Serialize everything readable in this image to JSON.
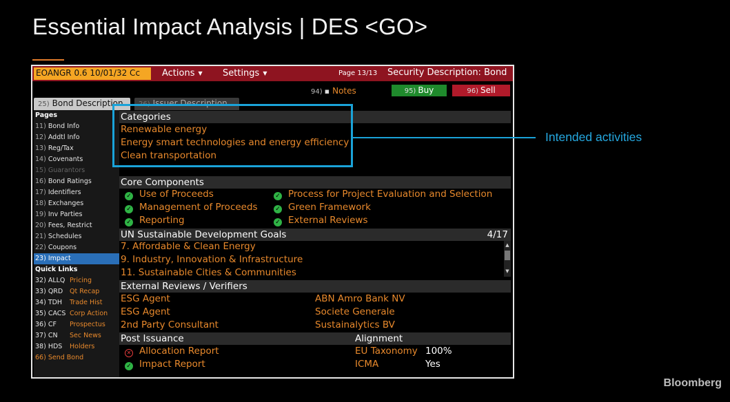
{
  "slide": {
    "title": "Essential Impact Analysis | DES <GO>",
    "brand": "Bloomberg"
  },
  "callout": {
    "label": "Intended activities"
  },
  "topbar": {
    "ticker": "EOANGR 0.6 10/01/32 Cc",
    "actions": "Actions",
    "settings": "Settings",
    "page": "Page 13/13",
    "title": "Security Description: Bond"
  },
  "toolbar": {
    "notes_num": "94)",
    "notes": "Notes",
    "buy_num": "95)",
    "buy": "Buy",
    "sell_num": "96)",
    "sell": "Sell"
  },
  "tabs": [
    {
      "num": "25)",
      "label": "Bond Description"
    },
    {
      "num": "26)",
      "label": "Issuer Description"
    }
  ],
  "sidebar": {
    "pages_heading": "Pages",
    "pages": [
      {
        "num": "11)",
        "label": "Bond Info"
      },
      {
        "num": "12)",
        "label": "Addtl Info"
      },
      {
        "num": "13)",
        "label": "Reg/Tax"
      },
      {
        "num": "14)",
        "label": "Covenants"
      },
      {
        "num": "15)",
        "label": "Guarantors"
      },
      {
        "num": "16)",
        "label": "Bond Ratings"
      },
      {
        "num": "17)",
        "label": "Identifiers"
      },
      {
        "num": "18)",
        "label": "Exchanges"
      },
      {
        "num": "19)",
        "label": "Inv Parties"
      },
      {
        "num": "20)",
        "label": "Fees, Restrict"
      },
      {
        "num": "21)",
        "label": "Schedules"
      },
      {
        "num": "22)",
        "label": "Coupons"
      },
      {
        "num": "23)",
        "label": "Impact"
      }
    ],
    "quick_heading": "Quick Links",
    "quick": [
      {
        "code": "32) ALLQ",
        "label": "Pricing"
      },
      {
        "code": "33) QRD",
        "label": "Qt Recap"
      },
      {
        "code": "34) TDH",
        "label": "Trade Hist"
      },
      {
        "code": "35) CACS",
        "label": "Corp Action"
      },
      {
        "code": "36) CF",
        "label": "Prospectus"
      },
      {
        "code": "37) CN",
        "label": "Sec News"
      },
      {
        "code": "38) HDS",
        "label": "Holders"
      }
    ],
    "send": "66) Send Bond"
  },
  "categories": {
    "heading": "Categories",
    "items": [
      "Renewable energy",
      "Energy smart technologies and energy efficiency",
      "Clean transportation"
    ]
  },
  "core": {
    "heading": "Core Components",
    "left": [
      "Use of Proceeds",
      "Management of Proceeds",
      "Reporting"
    ],
    "right": [
      "Process for Project Evaluation and Selection",
      "Green Framework",
      "External Reviews"
    ]
  },
  "sdg": {
    "heading": "UN Sustainable Development Goals",
    "count": "4/17",
    "items": [
      "7. Affordable & Clean Energy",
      "9. Industry, Innovation & Infrastructure",
      "11. Sustainable Cities & Communities"
    ]
  },
  "reviews": {
    "heading": "External Reviews / Verifiers",
    "left": [
      "ESG Agent",
      "ESG Agent",
      "2nd Party Consultant"
    ],
    "right": [
      "ABN Amro Bank NV",
      "Societe Generale",
      "Sustainalytics BV"
    ]
  },
  "post": {
    "heading": "Post Issuance",
    "alignment_heading": "Alignment",
    "items": [
      "Allocation Report",
      "Impact Report"
    ],
    "alignment": [
      {
        "label": "EU Taxonomy",
        "value": "100%"
      },
      {
        "label": "ICMA",
        "value": "Yes"
      }
    ]
  },
  "colors": {
    "accent_orange": "#e8892c",
    "callout_blue": "#1aa3d9",
    "topbar_red": "#8e1420",
    "check_green": "#2fb345"
  }
}
